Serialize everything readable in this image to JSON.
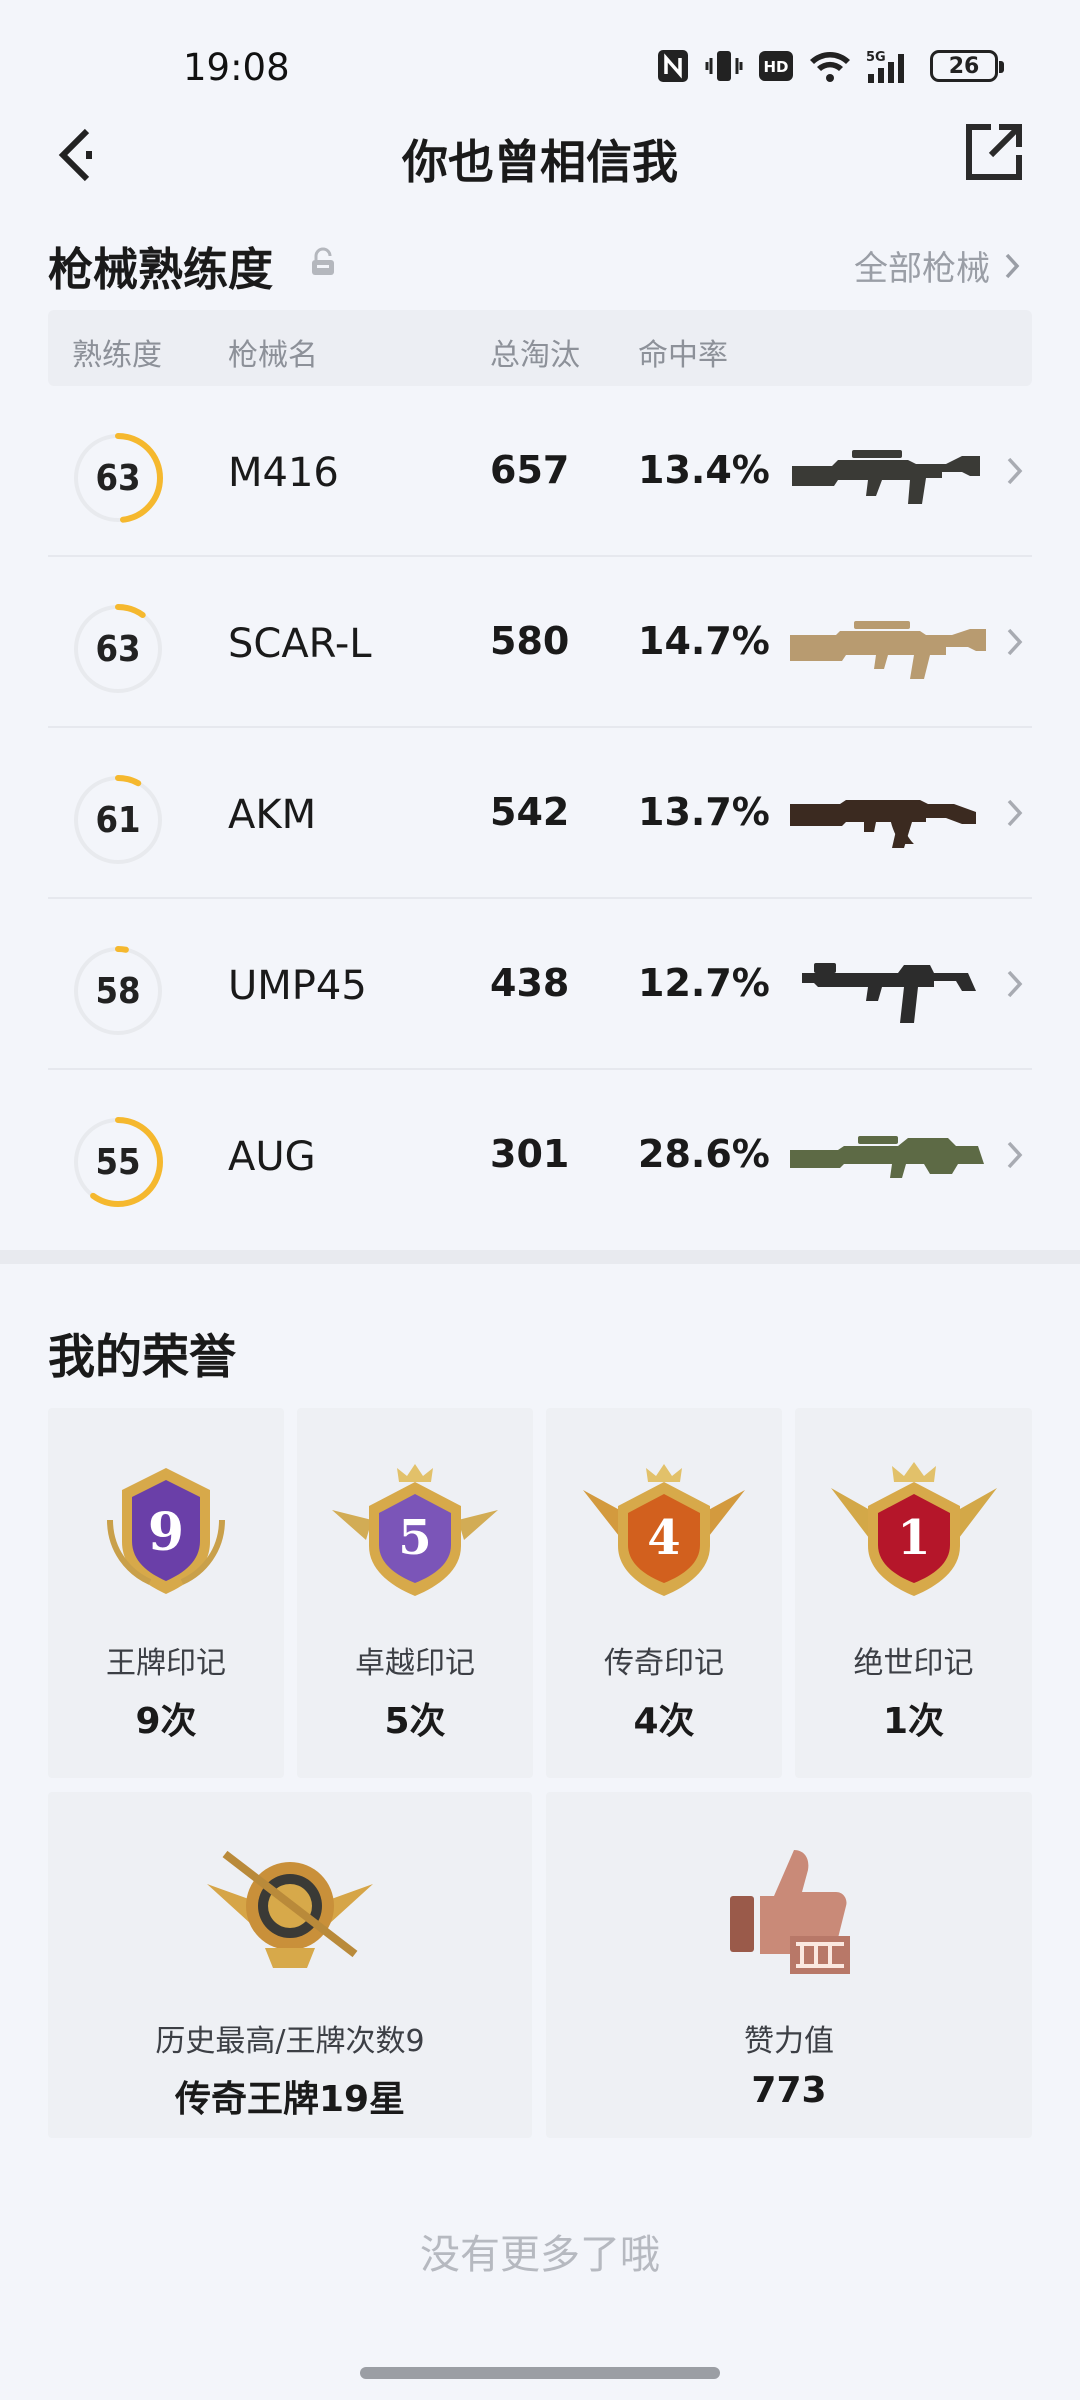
{
  "status": {
    "time": "19:08",
    "battery": "26"
  },
  "nav": {
    "title": "你也曾相信我"
  },
  "weapons_section": {
    "title": "枪械熟练度",
    "all_link": "全部枪械",
    "headers": {
      "proficiency": "熟练度",
      "name": "枪械名",
      "kills": "总淘汰",
      "accuracy": "命中率"
    },
    "rows": [
      {
        "level": "63",
        "progress": 0.48,
        "name": "M416",
        "kills": "657",
        "accuracy": "13.4%",
        "icon": "m416-rifle-icon",
        "gun_color": "#3a3a36"
      },
      {
        "level": "63",
        "progress": 0.1,
        "name": "SCAR-L",
        "kills": "580",
        "accuracy": "14.7%",
        "icon": "scar-l-rifle-icon",
        "gun_color": "#b89b70"
      },
      {
        "level": "61",
        "progress": 0.08,
        "name": "AKM",
        "kills": "542",
        "accuracy": "13.7%",
        "icon": "akm-rifle-icon",
        "gun_color": "#3b2a20"
      },
      {
        "level": "58",
        "progress": 0.03,
        "name": "UMP45",
        "kills": "438",
        "accuracy": "12.7%",
        "icon": "ump45-smg-icon",
        "gun_color": "#2c2c2c"
      },
      {
        "level": "55",
        "progress": 0.6,
        "name": "AUG",
        "kills": "301",
        "accuracy": "28.6%",
        "icon": "aug-rifle-icon",
        "gun_color": "#5d6a45"
      }
    ]
  },
  "honors": {
    "title": "我的荣誉",
    "marks": [
      {
        "label": "王牌印记",
        "value": "9次",
        "badge": "9",
        "icon": "ace-mark-medal-icon",
        "color": "#6a3fa8"
      },
      {
        "label": "卓越印记",
        "value": "5次",
        "badge": "5",
        "icon": "excellence-mark-medal-icon",
        "color": "#7b55b8"
      },
      {
        "label": "传奇印记",
        "value": "4次",
        "badge": "4",
        "icon": "legend-mark-medal-icon",
        "color": "#d2601e"
      },
      {
        "label": "绝世印记",
        "value": "1次",
        "badge": "1",
        "icon": "peerless-mark-medal-icon",
        "color": "#b5162a"
      }
    ],
    "highest": {
      "label": "历史最高/王牌次数9",
      "value": "传奇王牌19星",
      "icon": "highest-rank-emblem-icon"
    },
    "likes": {
      "label": "赞力值",
      "value": "773",
      "icon": "thumbs-up-icon"
    }
  },
  "footer": {
    "no_more": "没有更多了哦"
  },
  "colors": {
    "accent": "#f5b82e",
    "ring_track": "#e8eaee"
  }
}
